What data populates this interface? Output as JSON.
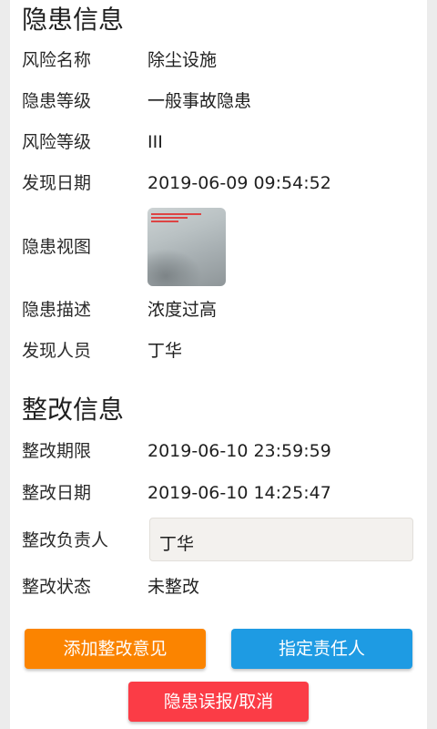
{
  "hazard_info": {
    "title": "隐患信息",
    "rows": [
      {
        "label": "风险名称",
        "value": "除尘设施"
      },
      {
        "label": "隐患等级",
        "value": "一般事故隐患"
      },
      {
        "label": "风险等级",
        "value": "III"
      },
      {
        "label": "发现日期",
        "value": "2019-06-09 09:54:52"
      },
      {
        "label": "隐患视图",
        "value": ""
      },
      {
        "label": "隐患描述",
        "value": "浓度过高"
      },
      {
        "label": "发现人员",
        "value": "丁华"
      }
    ]
  },
  "rectify_info": {
    "title": "整改信息",
    "deadline_label": "整改期限",
    "deadline_value": "2019-06-10 23:59:59",
    "date_label": "整改日期",
    "date_value": "2019-06-10 14:25:47",
    "owner_label": "整改负责人",
    "owner_value": "丁华",
    "status_label": "整改状态",
    "status_value": "未整改"
  },
  "actions": {
    "add_opinion": "添加整改意见",
    "assign_owner": "指定责任人",
    "false_report_cancel": "隐患误报/取消"
  },
  "colors": {
    "orange": "#fb8400",
    "blue": "#1e9be3",
    "red": "#fb3c46"
  }
}
